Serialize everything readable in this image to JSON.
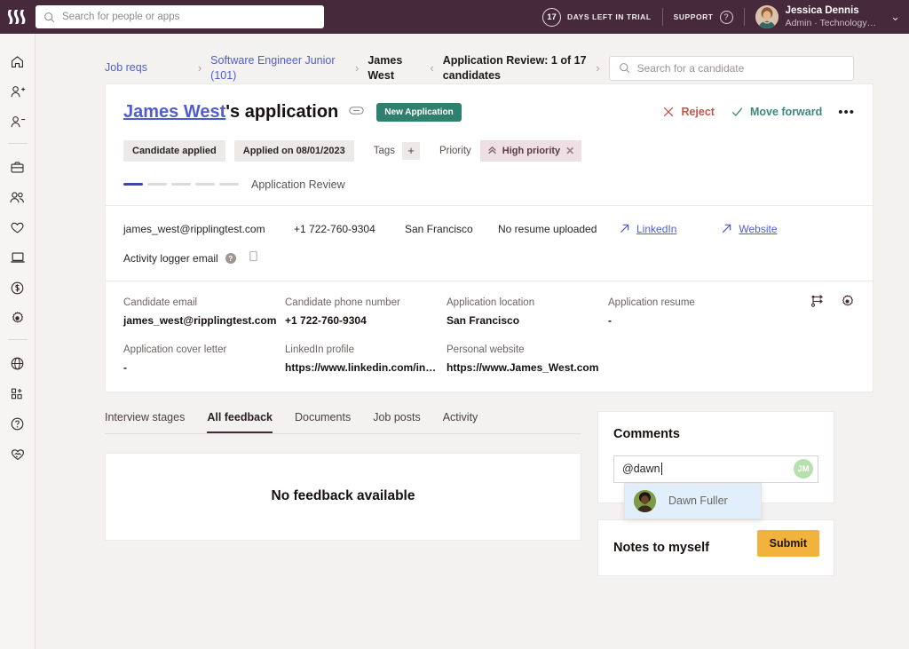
{
  "topbar": {
    "logo": "rippling-logo",
    "search_placeholder": "Search for people or apps",
    "trial_days": "17",
    "trial_label": "DAYS LEFT IN TRIAL",
    "support_label": "SUPPORT",
    "help_glyph": "?",
    "user_name": "Jessica Dennis",
    "user_role": "Admin · Technology…",
    "bg_color": "#46293a"
  },
  "rail": {
    "items": [
      {
        "icon": "home-icon",
        "name": "sidebar-item-home"
      },
      {
        "icon": "person-add-icon",
        "name": "sidebar-item-add-person"
      },
      {
        "icon": "person-remove-icon",
        "name": "sidebar-item-remove-person"
      },
      {
        "icon": "briefcase-icon",
        "name": "sidebar-item-jobs"
      },
      {
        "icon": "people-icon",
        "name": "sidebar-item-people"
      },
      {
        "icon": "heart-icon",
        "name": "sidebar-item-benefits"
      },
      {
        "icon": "laptop-icon",
        "name": "sidebar-item-devices"
      },
      {
        "icon": "dollar-circle-icon",
        "name": "sidebar-item-payroll"
      },
      {
        "icon": "gear-icon",
        "name": "sidebar-item-settings"
      },
      {
        "icon": "globe-icon",
        "name": "sidebar-item-global"
      },
      {
        "icon": "apps-add-icon",
        "name": "sidebar-item-apps"
      },
      {
        "icon": "question-circle-icon",
        "name": "sidebar-item-help"
      },
      {
        "icon": "handshake-icon",
        "name": "sidebar-item-partners"
      }
    ]
  },
  "breadcrumb": {
    "items": [
      {
        "label": "Job reqs",
        "type": "link"
      },
      {
        "label": "Software Engineer Junior (101)",
        "type": "link"
      },
      {
        "label": "James West",
        "type": "name"
      },
      {
        "label": "Application Review: 1 of 17 candidates",
        "type": "current"
      }
    ],
    "sep_right": "›",
    "sep_left": "‹",
    "sep_end": "›"
  },
  "candidate_search": {
    "placeholder": "Search for a candidate",
    "icon": "search-icon"
  },
  "application": {
    "name_link": "James West",
    "title_suffix": "'s application",
    "link_icon": "link-icon",
    "status_badge": "New Application",
    "status_badge_color": "#30806e",
    "reject_label": "Reject",
    "reject_icon": "close-icon",
    "move_forward_label": "Move forward",
    "move_forward_icon": "check-icon",
    "more_icon": "more-dots-icon",
    "chips": [
      "Candidate applied",
      "Applied on 08/01/2023"
    ],
    "tags_label": "Tags",
    "tags_add_icon": "plus-icon",
    "priority_label": "Priority",
    "priority_value": "High priority",
    "priority_icon": "double-chevron-up-icon",
    "priority_remove_icon": "close-icon",
    "stage_label": "Application Review",
    "stage_total": 5,
    "stage_current": 1
  },
  "contact": {
    "email": "james_west@ripplingtest.com",
    "phone": "+1 722-760-9304",
    "location": "San Francisco",
    "resume": "No resume uploaded",
    "links": [
      {
        "label": "LinkedIn",
        "icon": "arrow-up-right-icon"
      },
      {
        "label": "Website",
        "icon": "arrow-up-right-icon"
      }
    ],
    "activity_logger_label": "Activity logger email",
    "activity_help_icon": "help-icon",
    "activity_copy_icon": "copy-icon"
  },
  "details": {
    "toolbar_icons": [
      {
        "icon": "share-nodes-icon",
        "name": "share-button"
      },
      {
        "icon": "gear-icon",
        "name": "settings-button"
      }
    ],
    "rows": [
      [
        {
          "label": "Candidate email",
          "value": "james_west@ripplingtest.com"
        },
        {
          "label": "Candidate phone number",
          "value": "+1 722-760-9304"
        },
        {
          "label": "Application location",
          "value": "San Francisco"
        },
        {
          "label": "Application resume",
          "value": "-"
        }
      ],
      [
        {
          "label": "Application cover letter",
          "value": "-"
        },
        {
          "label": "LinkedIn profile",
          "value": "https://www.linkedin.com/in…"
        },
        {
          "label": "Personal website",
          "value": "https://www.James_West.com"
        }
      ]
    ]
  },
  "tabs": [
    {
      "label": "Interview stages",
      "active": false
    },
    {
      "label": "All feedback",
      "active": true
    },
    {
      "label": "Documents",
      "active": false
    },
    {
      "label": "Job posts",
      "active": false
    },
    {
      "label": "Activity",
      "active": false
    }
  ],
  "feedback": {
    "empty_text": "No feedback available"
  },
  "comments": {
    "heading": "Comments",
    "input_value": "@dawn",
    "avatar_initials": "JM",
    "avatar_color": "#b7e0ae",
    "mention_suggestion": "Dawn Fuller",
    "mention_highlight_color": "#e1eefb",
    "submit_label": "Submit",
    "submit_color": "#f2b33d"
  },
  "notes": {
    "heading": "Notes to myself",
    "chevron_icon": "chevron-down-icon"
  }
}
